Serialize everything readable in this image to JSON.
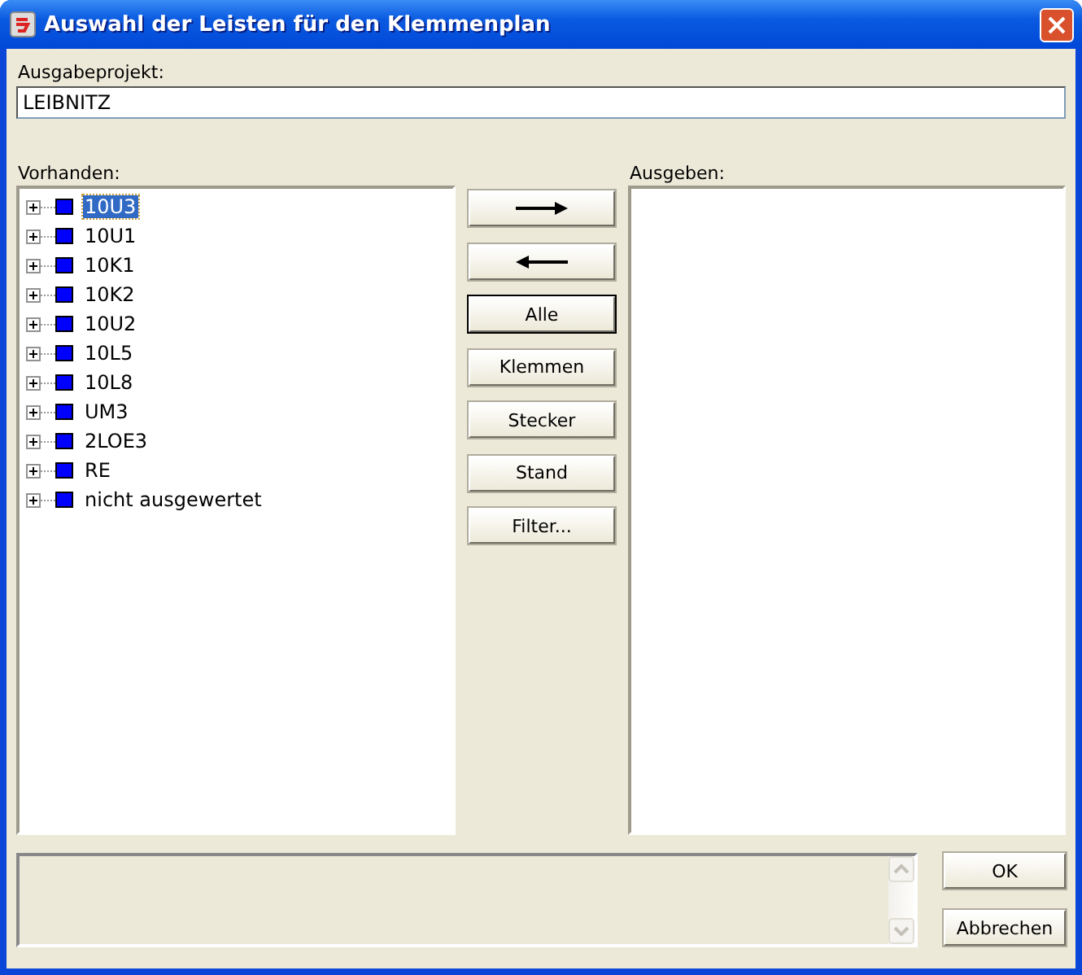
{
  "window": {
    "title": "Auswahl der Leisten für den Klemmenplan"
  },
  "project": {
    "label": "Ausgabeprojekt:",
    "value": "LEIBNITZ"
  },
  "available": {
    "label": "Vorhanden:",
    "items": [
      {
        "label": "10U3",
        "selected": true,
        "color": "#0000ff"
      },
      {
        "label": "10U1",
        "selected": false,
        "color": "#0000ff"
      },
      {
        "label": "10K1",
        "selected": false,
        "color": "#0000ff"
      },
      {
        "label": "10K2",
        "selected": false,
        "color": "#0000ff"
      },
      {
        "label": "10U2",
        "selected": false,
        "color": "#0000ff"
      },
      {
        "label": "10L5",
        "selected": false,
        "color": "#0000ff"
      },
      {
        "label": "10L8",
        "selected": false,
        "color": "#0000ff"
      },
      {
        "label": "UM3",
        "selected": false,
        "color": "#0000ff"
      },
      {
        "label": "2LOE3",
        "selected": false,
        "color": "#0000ff"
      },
      {
        "label": "RE",
        "selected": false,
        "color": "#0000ff"
      },
      {
        "label": "nicht ausgewertet",
        "selected": false,
        "color": "#0000ff"
      }
    ]
  },
  "middle_buttons": [
    {
      "kind": "arrow-right"
    },
    {
      "kind": "arrow-left"
    },
    {
      "kind": "text",
      "label": "Alle",
      "default": true
    },
    {
      "kind": "text",
      "label": "Klemmen",
      "default": false
    },
    {
      "kind": "text",
      "label": "Stecker",
      "default": false
    },
    {
      "kind": "text",
      "label": "Stand",
      "default": false
    },
    {
      "kind": "text",
      "label": "Filter...",
      "default": false
    }
  ],
  "output": {
    "label": "Ausgeben:"
  },
  "dialog_buttons": [
    "OK",
    "Abbrechen"
  ]
}
